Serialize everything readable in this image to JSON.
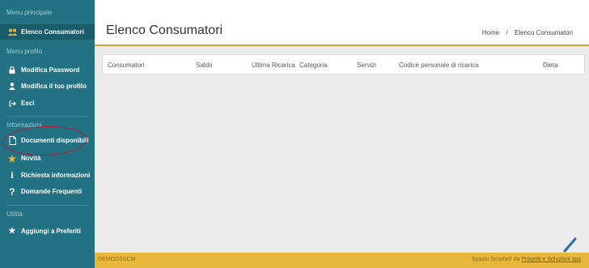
{
  "sidebar": {
    "sections": [
      {
        "title": "Menu principale"
      },
      {
        "title": "Menu profilo"
      },
      {
        "title": "Informazioni"
      },
      {
        "title": "Utilità"
      }
    ],
    "items": [
      {
        "label": "Elenco Consumatori",
        "icon": "users-icon"
      },
      {
        "label": "Modifica Password",
        "icon": "lock-icon"
      },
      {
        "label": "Modifica il tuo profilo",
        "icon": "user-icon"
      },
      {
        "label": "Esci",
        "icon": "sign-out-icon"
      },
      {
        "label": "Documenti disponibili",
        "icon": "document-icon"
      },
      {
        "label": "Novità",
        "icon": "news-icon"
      },
      {
        "label": "Richiesta informazioni",
        "icon": "info-icon"
      },
      {
        "label": "Domande Frequenti",
        "icon": "question-icon"
      },
      {
        "label": "Aggiungi a Preferiti",
        "icon": "star-icon"
      }
    ]
  },
  "header": {
    "title": "Elenco Consumatori",
    "breadcrumb": {
      "home": "Home",
      "separator": "/",
      "current": "Elenco Consumatori"
    }
  },
  "table": {
    "columns": [
      "Consumatori",
      "Saldo",
      "Ultima Ricarica",
      "Categoria",
      "Servizi",
      "Codice personale di ricarica",
      "Dieta"
    ]
  },
  "footer": {
    "code": "DEMODSSCM",
    "credit_prefix": "Spazio Scuola® da",
    "credit_link": "Progetti e Soluzioni spa"
  },
  "colors": {
    "sidebar": "#227284",
    "accent": "#c9a53a",
    "footer": "#e8b83c",
    "annotation": "#b41e3c"
  }
}
